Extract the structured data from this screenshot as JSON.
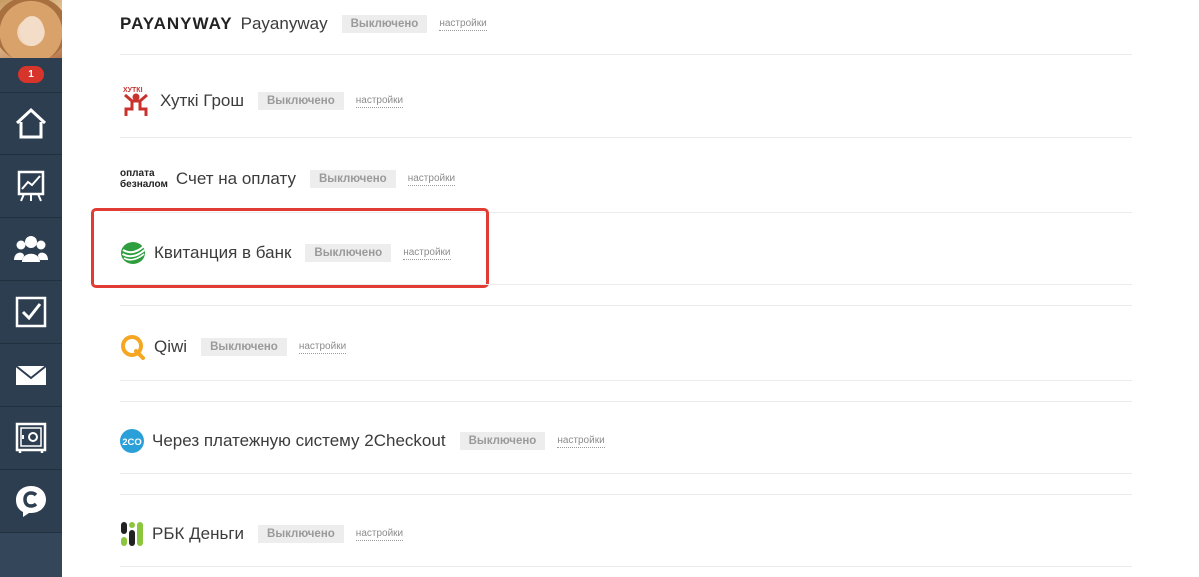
{
  "sidebar": {
    "badge_count": "1",
    "nav_items": [
      {
        "icon": "home-icon"
      },
      {
        "icon": "chart-icon"
      },
      {
        "icon": "users-icon"
      },
      {
        "icon": "checkbox-icon"
      },
      {
        "icon": "mail-icon"
      },
      {
        "icon": "safe-icon"
      },
      {
        "icon": "chat-c-icon"
      }
    ]
  },
  "payment_methods": [
    {
      "logo_text": "PAYANYWAY",
      "name": "Payanyway",
      "status": "Выключено",
      "settings": "настройки"
    },
    {
      "logo_text": "ХУТКІ",
      "name": "Хуткі Грош",
      "status": "Выключено",
      "settings": "настройки"
    },
    {
      "logo_text_line1": "оплата",
      "logo_text_line2": "безналом",
      "name": "Счет на оплату",
      "status": "Выключено",
      "settings": "настройки"
    },
    {
      "name": "Квитанция в банк",
      "status": "Выключено",
      "settings": "настройки"
    },
    {
      "name": "Qiwi",
      "status": "Выключено",
      "settings": "настройки"
    },
    {
      "logo_text": "2CO",
      "name": "Через платежную систему 2Checkout",
      "status": "Выключено",
      "settings": "настройки"
    },
    {
      "name": "РБК Деньги",
      "status": "Выключено",
      "settings": "настройки"
    }
  ],
  "colors": {
    "sidebar_bg": "#2d3e50",
    "badge": "#d7352b",
    "highlight": "#e03c34",
    "status_bg": "#ededed"
  }
}
